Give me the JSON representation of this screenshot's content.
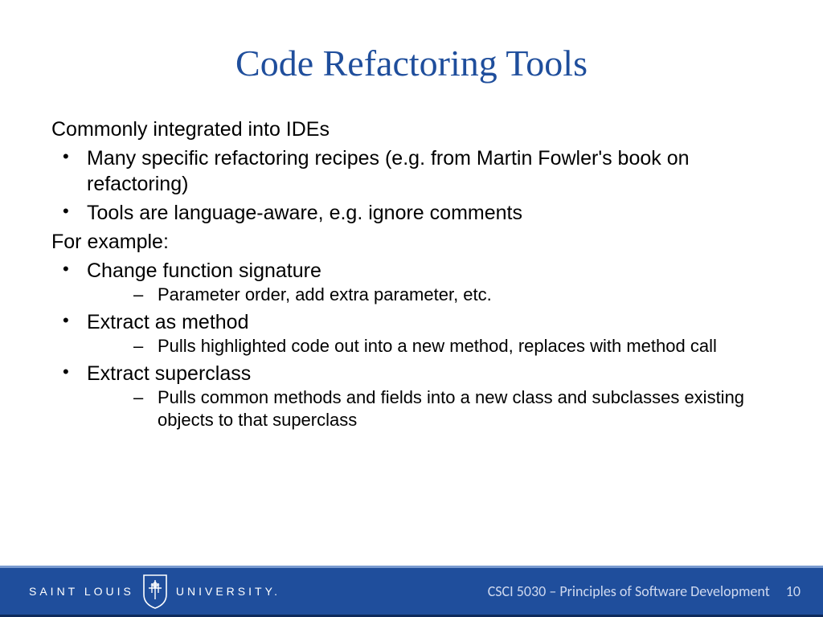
{
  "title": "Code Refactoring Tools",
  "content": {
    "intro": "Commonly integrated into IDEs",
    "bullets1": [
      "Many specific refactoring recipes (e.g. from Martin Fowler's book on refactoring)",
      "Tools are language-aware, e.g. ignore comments"
    ],
    "example_label": "For example:",
    "examples": [
      {
        "item": "Change function signature",
        "sub": [
          "Parameter order, add extra parameter, etc."
        ]
      },
      {
        "item": "Extract as method",
        "sub": [
          "Pulls highlighted code out into a new method, replaces with method call"
        ]
      },
      {
        "item": "Extract superclass",
        "sub": [
          "Pulls common methods and fields into a new class and subclasses existing objects to that superclass"
        ]
      }
    ]
  },
  "footer": {
    "logo_left": "SAINT LOUIS",
    "logo_right": "UNIVERSITY.",
    "course": "CSCI 5030 – Principles of Software Development",
    "page": "10"
  },
  "colors": {
    "accent": "#1f4e9c"
  }
}
